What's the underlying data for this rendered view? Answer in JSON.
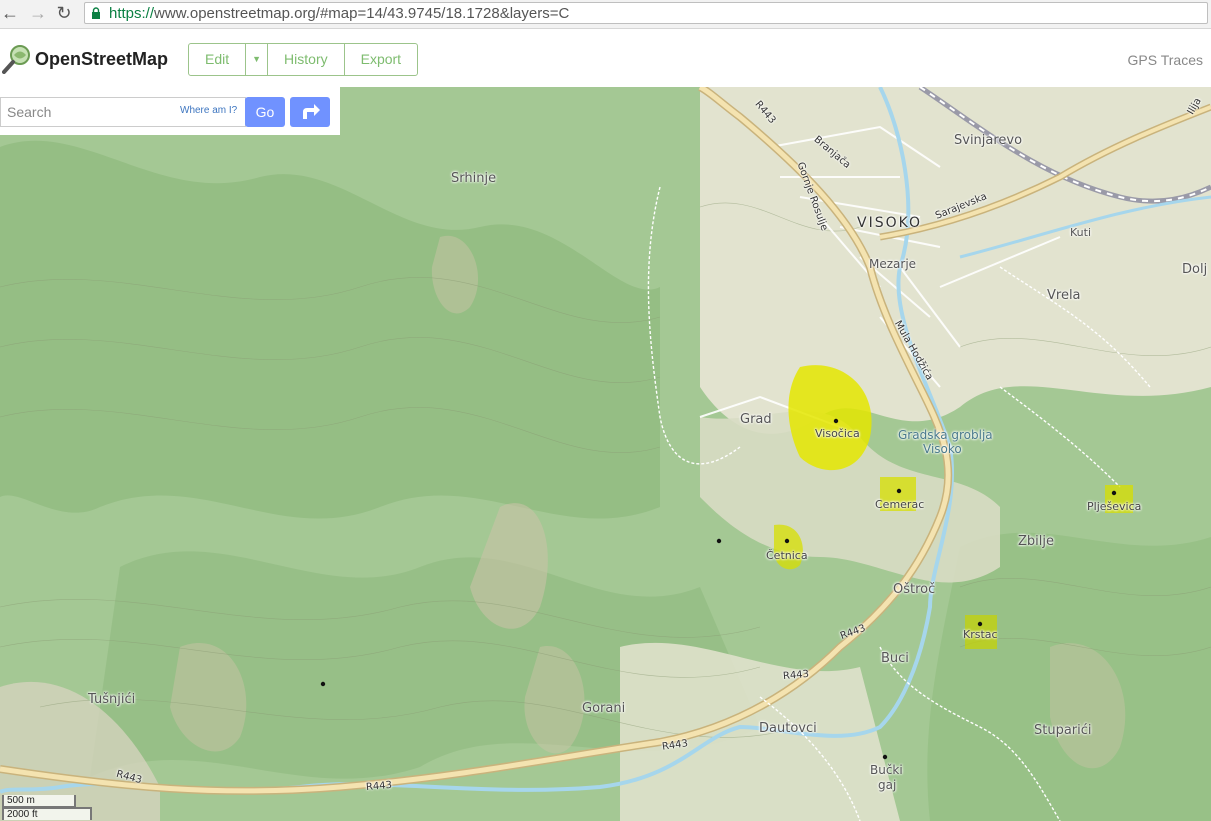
{
  "browser": {
    "url_scheme": "https://",
    "url_rest": "www.openstreetmap.org/#map=14/43.9745/18.1728&layers=C",
    "back_glyph": "←",
    "forward_glyph": "→",
    "reload_glyph": "↻"
  },
  "header": {
    "brand": "OpenStreetMap",
    "edit_label": "Edit",
    "history_label": "History",
    "export_label": "Export",
    "gps_traces_label": "GPS Traces"
  },
  "search": {
    "placeholder": "Search",
    "where_am_i": "Where am I?",
    "go_label": "Go"
  },
  "scale": {
    "metric": "500 m",
    "imperial": "2000 ft"
  },
  "map": {
    "places": {
      "srhinje": "Srhinje",
      "svinjarevo": "Svinjarevo",
      "visoko": "VISOKO",
      "mezarje": "Mezarje",
      "kuti": "Kuti",
      "dolj": "Dolj",
      "vrela": "Vrela",
      "grad": "Grad",
      "zbilje": "Zbilje",
      "ostroc": "Oštroč",
      "buci": "Buci",
      "tusnjici": "Tušnjići",
      "gorani": "Gorani",
      "dautovci": "Dautovci",
      "stuparici": "Stuparići",
      "bucki_gaj_1": "Bučki",
      "bucki_gaj_2": "gaj",
      "gradska_groblja_1": "Gradska groblja",
      "gradska_groblja_2": "Visoko"
    },
    "peaks": {
      "visocica": "Visočica",
      "cemerac": "Cemerac",
      "cetnica": "Četnica",
      "krstac": "Krstac",
      "pljesevica": "Plješevica"
    },
    "roads": {
      "r443_a": "R443",
      "r443_b": "R443",
      "r443_c": "R443",
      "r443_d": "R443",
      "r443_e": "R443",
      "r443_f": "R443",
      "branjaca": "Branjača",
      "gornje_rosulje": "Gornje Rosulje",
      "sarajevska": "Sarajevska",
      "mula_hodzica": "Mula Hodžića",
      "ilija": "Ilija"
    },
    "colors": {
      "forest": "#9ec48c",
      "forest_dark": "#7fae70",
      "meadow": "#d9dcc2",
      "hillshade": "#c8c2a8",
      "road": "#f4e3b0",
      "road_casing": "#c9b37c",
      "river": "#a6d6ec",
      "railway": "#9a9aa8",
      "highlight": "#e4e600"
    }
  }
}
